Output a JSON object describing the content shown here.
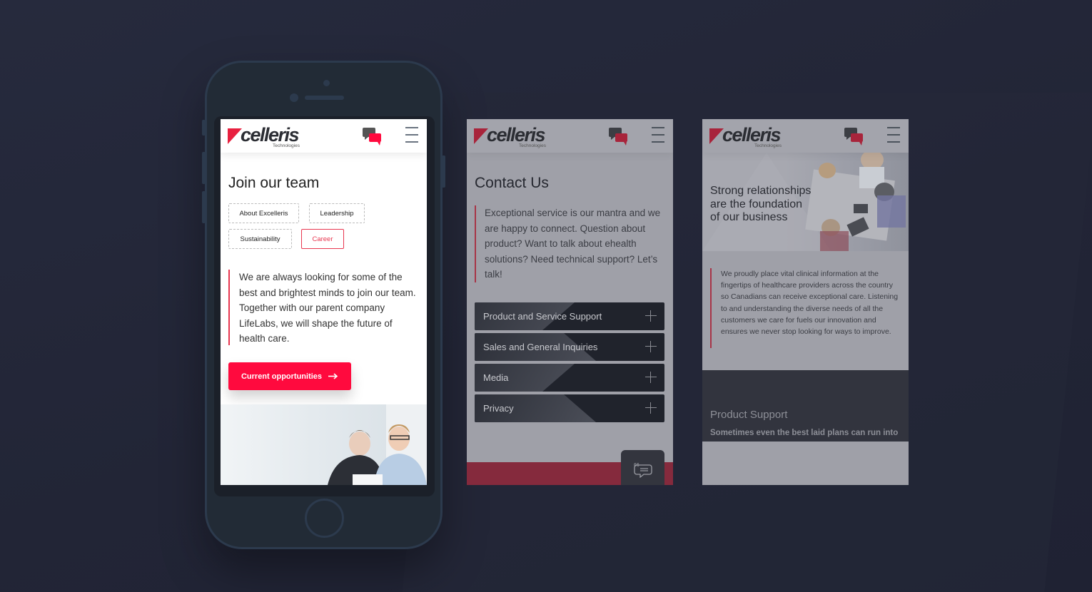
{
  "brand": {
    "logo_text": "celleris",
    "logo_sub": "Technologies",
    "accent_color": "#ff0a3e",
    "icons": [
      "chat-bubbles-icon",
      "hamburger-menu-icon"
    ]
  },
  "screens": [
    {
      "id": "career",
      "title": "Join our team",
      "nav_pills": [
        {
          "label": "About Excelleris",
          "active": false
        },
        {
          "label": "Leadership",
          "active": false
        },
        {
          "label": "Sustainability",
          "active": false
        },
        {
          "label": "Career",
          "active": true
        }
      ],
      "body": "We are always looking for some of the best and brightest minds to join our team. Together with our parent company LifeLabs, we will shape the future of health care.",
      "cta_label": "Current opportunities",
      "cta_icon": "arrow-right-icon"
    },
    {
      "id": "contact",
      "title": "Contact Us",
      "body": "Exceptional service is our mantra and we are happy to connect. Question about product? Want to talk about ehealth solutions? Need technical support? Let’s talk!",
      "accordion": [
        {
          "label": "Product and Service Support"
        },
        {
          "label": "Sales and General Inquiries"
        },
        {
          "label": "Media"
        },
        {
          "label": "Privacy"
        }
      ],
      "chat_button_icon": "chat-quote-icon"
    },
    {
      "id": "about",
      "hero_title_lines": [
        "Strong relationships",
        "are the foundation",
        "of our business"
      ],
      "body": "We proudly place vital clinical information at the fingertips of healthcare providers across the country so Canadians can receive exceptional care. Listening to and understanding the diverse needs of all the customers we care for fuels our innovation and ensures we never stop looking for ways to improve.",
      "section_title": "Product Support",
      "section_sub": "Sometimes even the best laid plans can run into"
    }
  ]
}
